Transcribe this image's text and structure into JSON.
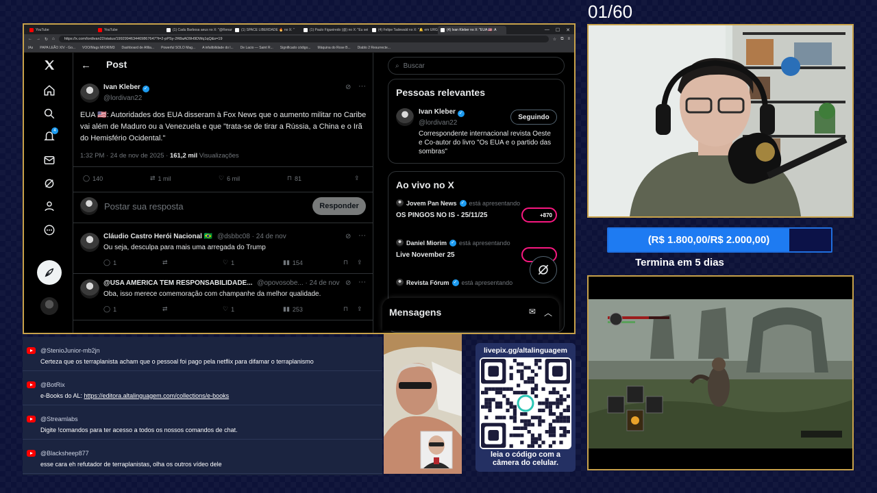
{
  "counter": "01/60",
  "browser": {
    "tabs": [
      {
        "label": "YouTube",
        "color": "#ff0000"
      },
      {
        "label": "YouTube",
        "color": "#ff0000"
      },
      {
        "label": "(1) Cadu Barbosa aeus no X: \"@Renan",
        "color": "#ffffff"
      },
      {
        "label": "(1) SPACE LIBERDADE 🔥 no X: \"",
        "color": "#ffffff"
      },
      {
        "label": "(1) Paulo Figueiredo (@) no X: \"Eu sei",
        "color": "#ffffff"
      },
      {
        "label": "(4) Felipe Tadewald no X: \"🔔 em URG",
        "color": "#ffffff"
      },
      {
        "label": "(4) Ivan Kleber no X: \"EUA 🇺🇸: A",
        "color": "#ffffff",
        "active": true
      }
    ],
    "url": "https://x.com/lordivan22/status/1992994634469867647?t=2-pPSy-2R8aAD9H9DWq1qQ&s=19",
    "bookmarks": [
      "IAs",
      "PAPA LEÃO XIV - Go...",
      "VOO/Mags MIORIM3",
      "Dashboard de Afilia...",
      "Powerful SOLO Mag...",
      "A infalibilidade do l...",
      "De Lacio — Saint R...",
      "Significado código...",
      "Máquina do Rose B...",
      "Diablo 2 Resurrecte..."
    ]
  },
  "post": {
    "header": "Post",
    "author_name": "Ivan Kleber",
    "author_handle": "@lordivan22",
    "text": "EUA 🇺🇸: Autoridades dos EUA disseram à Fox News que o aumento militar no Caribe vai além de Maduro ou a Venezuela e que \"trata-se de tirar a Rússia, a China e o Irã do Hemisfério Ocidental.\"",
    "meta_time": "1:32 PM · 24 de nov de 2025 · ",
    "views_count": "161,2 mil",
    "views_label": " Visualizações",
    "stats": {
      "replies": "140",
      "reposts": "1 mil",
      "likes": "6 mil",
      "bookmarks": "81"
    },
    "reply_placeholder": "Postar sua resposta",
    "reply_button": "Responder"
  },
  "replies": [
    {
      "name": "Cláudio Castro Herói Nacional 🇧🇷",
      "handle": "@dsbbc08 · 24 de nov",
      "text": "Ou seja, desculpa para mais uma arregada do Trump",
      "replies": "1",
      "reposts": "",
      "likes": "1",
      "views": "154"
    },
    {
      "name": "@USA AMERICA TEM RESPONSABILIDADE...",
      "handle": "@opovosobe... · 24 de nov",
      "text": "Oba, isso merece comemoração com champanhe da melhor qualidade.",
      "replies": "1",
      "reposts": "",
      "likes": "1",
      "views": "253"
    }
  ],
  "sidebar": {
    "search_placeholder": "Buscar",
    "relevant_title": "Pessoas relevantes",
    "relevant_name": "Ivan Kleber",
    "relevant_handle": "@lordivan22",
    "follow_label": "Seguindo",
    "relevant_bio": "Correspondente internacional revista Oeste e Co-autor do livro \"Os EUA e o partido das sombras\"",
    "live_title": "Ao vivo no X",
    "live": [
      {
        "host": "Jovem Pan News",
        "status": "está apresentando",
        "title": "OS PINGOS NO IS - 25/11/25",
        "count": "+870"
      },
      {
        "host": "Daniel Miorim",
        "status": "está apresentando",
        "title": "Live November 25",
        "count": ""
      },
      {
        "host": "Revista Fórum",
        "status": "está apresentando",
        "title": "",
        "count": ""
      }
    ],
    "messages_label": "Mensagens"
  },
  "notification_count": "4",
  "goal": {
    "text": "(R$ 1.800,00/R$ 2.000,00)",
    "progress": 0.9,
    "ends": "Termina em 5 dias"
  },
  "chat": [
    {
      "user": "@StenioJunior-mb2jn",
      "text": "Certeza que os terraplanista acham que o pessoal foi pago pela netflix para difamar o terraplanismo"
    },
    {
      "user": "@BotRix",
      "text": "e-Books do AL: ",
      "link": "https://editora.altalinguagem.com/collections/e-books"
    },
    {
      "user": "@Streamlabs",
      "text": "Digite !comandos para ter acesso a todos os nossos comandos de chat."
    },
    {
      "user": "@Blacksheep877",
      "text": "esse cara eh refutador de terraplanistas, olha os outros vídeo dele"
    }
  ],
  "qr": {
    "url": "livepix.gg/altalinguagem",
    "caption_line1": "leia o código com a",
    "caption_line2": "câmera do celular."
  },
  "colors": {
    "x_blue": "#1d9bf0",
    "gold_border": "#c8a24a",
    "goal_blue": "#1e7bf2",
    "live_pink": "#f91880"
  }
}
